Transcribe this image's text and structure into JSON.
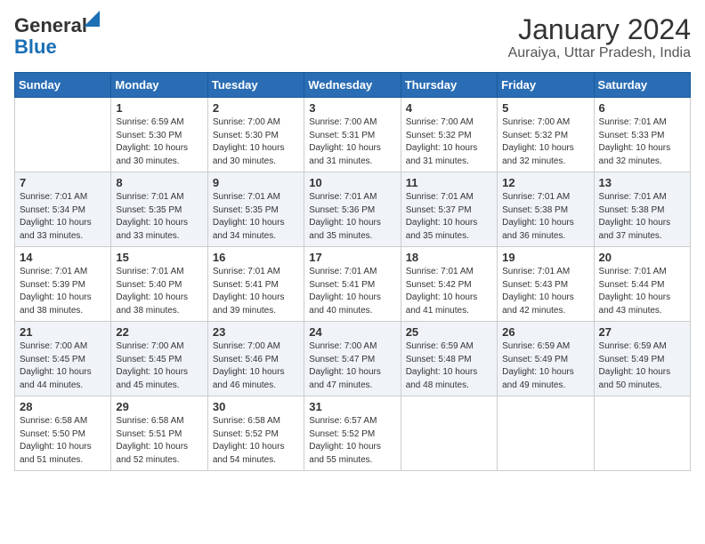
{
  "logo": {
    "line1": "General",
    "line2": "Blue"
  },
  "title": "January 2024",
  "subtitle": "Auraiya, Uttar Pradesh, India",
  "days_header": [
    "Sunday",
    "Monday",
    "Tuesday",
    "Wednesday",
    "Thursday",
    "Friday",
    "Saturday"
  ],
  "weeks": [
    [
      {
        "day": "",
        "sunrise": "",
        "sunset": "",
        "daylight": ""
      },
      {
        "day": "1",
        "sunrise": "Sunrise: 6:59 AM",
        "sunset": "Sunset: 5:30 PM",
        "daylight": "Daylight: 10 hours and 30 minutes."
      },
      {
        "day": "2",
        "sunrise": "Sunrise: 7:00 AM",
        "sunset": "Sunset: 5:30 PM",
        "daylight": "Daylight: 10 hours and 30 minutes."
      },
      {
        "day": "3",
        "sunrise": "Sunrise: 7:00 AM",
        "sunset": "Sunset: 5:31 PM",
        "daylight": "Daylight: 10 hours and 31 minutes."
      },
      {
        "day": "4",
        "sunrise": "Sunrise: 7:00 AM",
        "sunset": "Sunset: 5:32 PM",
        "daylight": "Daylight: 10 hours and 31 minutes."
      },
      {
        "day": "5",
        "sunrise": "Sunrise: 7:00 AM",
        "sunset": "Sunset: 5:32 PM",
        "daylight": "Daylight: 10 hours and 32 minutes."
      },
      {
        "day": "6",
        "sunrise": "Sunrise: 7:01 AM",
        "sunset": "Sunset: 5:33 PM",
        "daylight": "Daylight: 10 hours and 32 minutes."
      }
    ],
    [
      {
        "day": "7",
        "sunrise": "Sunrise: 7:01 AM",
        "sunset": "Sunset: 5:34 PM",
        "daylight": "Daylight: 10 hours and 33 minutes."
      },
      {
        "day": "8",
        "sunrise": "Sunrise: 7:01 AM",
        "sunset": "Sunset: 5:35 PM",
        "daylight": "Daylight: 10 hours and 33 minutes."
      },
      {
        "day": "9",
        "sunrise": "Sunrise: 7:01 AM",
        "sunset": "Sunset: 5:35 PM",
        "daylight": "Daylight: 10 hours and 34 minutes."
      },
      {
        "day": "10",
        "sunrise": "Sunrise: 7:01 AM",
        "sunset": "Sunset: 5:36 PM",
        "daylight": "Daylight: 10 hours and 35 minutes."
      },
      {
        "day": "11",
        "sunrise": "Sunrise: 7:01 AM",
        "sunset": "Sunset: 5:37 PM",
        "daylight": "Daylight: 10 hours and 35 minutes."
      },
      {
        "day": "12",
        "sunrise": "Sunrise: 7:01 AM",
        "sunset": "Sunset: 5:38 PM",
        "daylight": "Daylight: 10 hours and 36 minutes."
      },
      {
        "day": "13",
        "sunrise": "Sunrise: 7:01 AM",
        "sunset": "Sunset: 5:38 PM",
        "daylight": "Daylight: 10 hours and 37 minutes."
      }
    ],
    [
      {
        "day": "14",
        "sunrise": "Sunrise: 7:01 AM",
        "sunset": "Sunset: 5:39 PM",
        "daylight": "Daylight: 10 hours and 38 minutes."
      },
      {
        "day": "15",
        "sunrise": "Sunrise: 7:01 AM",
        "sunset": "Sunset: 5:40 PM",
        "daylight": "Daylight: 10 hours and 38 minutes."
      },
      {
        "day": "16",
        "sunrise": "Sunrise: 7:01 AM",
        "sunset": "Sunset: 5:41 PM",
        "daylight": "Daylight: 10 hours and 39 minutes."
      },
      {
        "day": "17",
        "sunrise": "Sunrise: 7:01 AM",
        "sunset": "Sunset: 5:41 PM",
        "daylight": "Daylight: 10 hours and 40 minutes."
      },
      {
        "day": "18",
        "sunrise": "Sunrise: 7:01 AM",
        "sunset": "Sunset: 5:42 PM",
        "daylight": "Daylight: 10 hours and 41 minutes."
      },
      {
        "day": "19",
        "sunrise": "Sunrise: 7:01 AM",
        "sunset": "Sunset: 5:43 PM",
        "daylight": "Daylight: 10 hours and 42 minutes."
      },
      {
        "day": "20",
        "sunrise": "Sunrise: 7:01 AM",
        "sunset": "Sunset: 5:44 PM",
        "daylight": "Daylight: 10 hours and 43 minutes."
      }
    ],
    [
      {
        "day": "21",
        "sunrise": "Sunrise: 7:00 AM",
        "sunset": "Sunset: 5:45 PM",
        "daylight": "Daylight: 10 hours and 44 minutes."
      },
      {
        "day": "22",
        "sunrise": "Sunrise: 7:00 AM",
        "sunset": "Sunset: 5:45 PM",
        "daylight": "Daylight: 10 hours and 45 minutes."
      },
      {
        "day": "23",
        "sunrise": "Sunrise: 7:00 AM",
        "sunset": "Sunset: 5:46 PM",
        "daylight": "Daylight: 10 hours and 46 minutes."
      },
      {
        "day": "24",
        "sunrise": "Sunrise: 7:00 AM",
        "sunset": "Sunset: 5:47 PM",
        "daylight": "Daylight: 10 hours and 47 minutes."
      },
      {
        "day": "25",
        "sunrise": "Sunrise: 6:59 AM",
        "sunset": "Sunset: 5:48 PM",
        "daylight": "Daylight: 10 hours and 48 minutes."
      },
      {
        "day": "26",
        "sunrise": "Sunrise: 6:59 AM",
        "sunset": "Sunset: 5:49 PM",
        "daylight": "Daylight: 10 hours and 49 minutes."
      },
      {
        "day": "27",
        "sunrise": "Sunrise: 6:59 AM",
        "sunset": "Sunset: 5:49 PM",
        "daylight": "Daylight: 10 hours and 50 minutes."
      }
    ],
    [
      {
        "day": "28",
        "sunrise": "Sunrise: 6:58 AM",
        "sunset": "Sunset: 5:50 PM",
        "daylight": "Daylight: 10 hours and 51 minutes."
      },
      {
        "day": "29",
        "sunrise": "Sunrise: 6:58 AM",
        "sunset": "Sunset: 5:51 PM",
        "daylight": "Daylight: 10 hours and 52 minutes."
      },
      {
        "day": "30",
        "sunrise": "Sunrise: 6:58 AM",
        "sunset": "Sunset: 5:52 PM",
        "daylight": "Daylight: 10 hours and 54 minutes."
      },
      {
        "day": "31",
        "sunrise": "Sunrise: 6:57 AM",
        "sunset": "Sunset: 5:52 PM",
        "daylight": "Daylight: 10 hours and 55 minutes."
      },
      {
        "day": "",
        "sunrise": "",
        "sunset": "",
        "daylight": ""
      },
      {
        "day": "",
        "sunrise": "",
        "sunset": "",
        "daylight": ""
      },
      {
        "day": "",
        "sunrise": "",
        "sunset": "",
        "daylight": ""
      }
    ]
  ]
}
